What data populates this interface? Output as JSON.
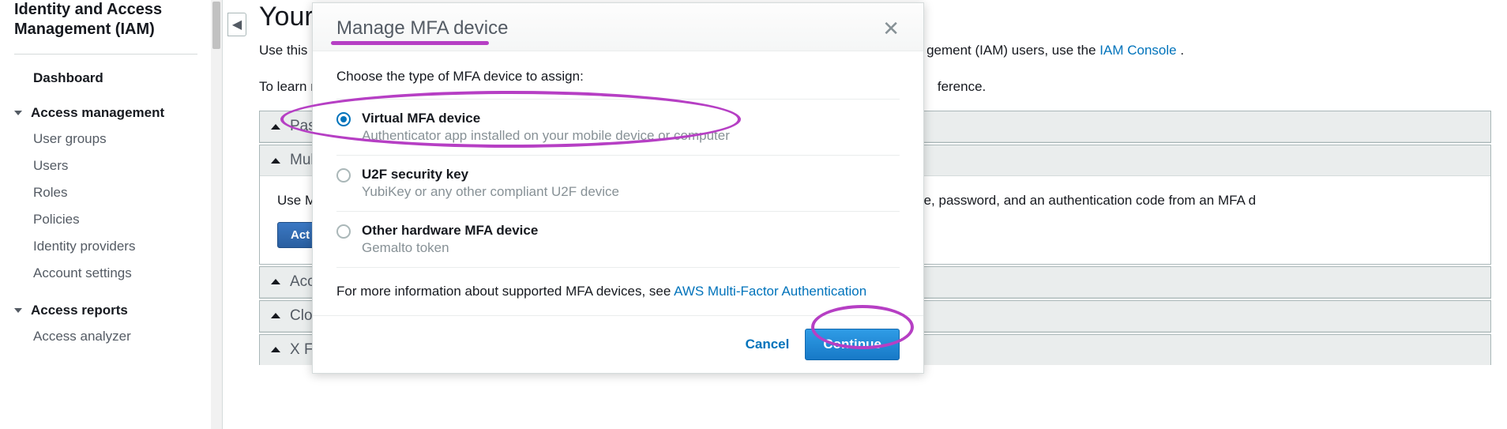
{
  "service_title": "Identity and Access Management (IAM)",
  "sidebar": {
    "dashboard": "Dashboard",
    "access_mgmt_header": "Access management",
    "access_mgmt_items": [
      "User groups",
      "Users",
      "Roles",
      "Policies",
      "Identity providers",
      "Account settings"
    ],
    "access_reports_header": "Access reports",
    "access_reports_items": [
      "Access analyzer"
    ]
  },
  "page": {
    "title": "Your",
    "desc_pre": "Use this p",
    "desc_post": "gement (IAM) users, use the ",
    "iam_console_link": "IAM Console",
    "desc_period": " .",
    "learn_pre": "To learn m",
    "learn_post": "ference."
  },
  "panels": {
    "p1_title": "Pas",
    "p2_title": "Mul",
    "p2_body_pre": "Use M",
    "p2_body_post": "e, password, and an authentication code from an MFA d",
    "p2_button": "Act",
    "p3_title": "Acc",
    "p4_title": "Clo",
    "p5_title": "X F"
  },
  "modal": {
    "title": "Manage MFA device",
    "choose_text": "Choose the type of MFA device to assign:",
    "options": [
      {
        "title": "Virtual MFA device",
        "desc": "Authenticator app installed on your mobile device or computer",
        "selected": true
      },
      {
        "title": "U2F security key",
        "desc": "YubiKey or any other compliant U2F device",
        "selected": false
      },
      {
        "title": "Other hardware MFA device",
        "desc": "Gemalto token",
        "selected": false
      }
    ],
    "more_info_pre": "For more information about supported MFA devices, see ",
    "more_info_link": "AWS Multi-Factor Authentication",
    "cancel": "Cancel",
    "continue": "Continue"
  }
}
